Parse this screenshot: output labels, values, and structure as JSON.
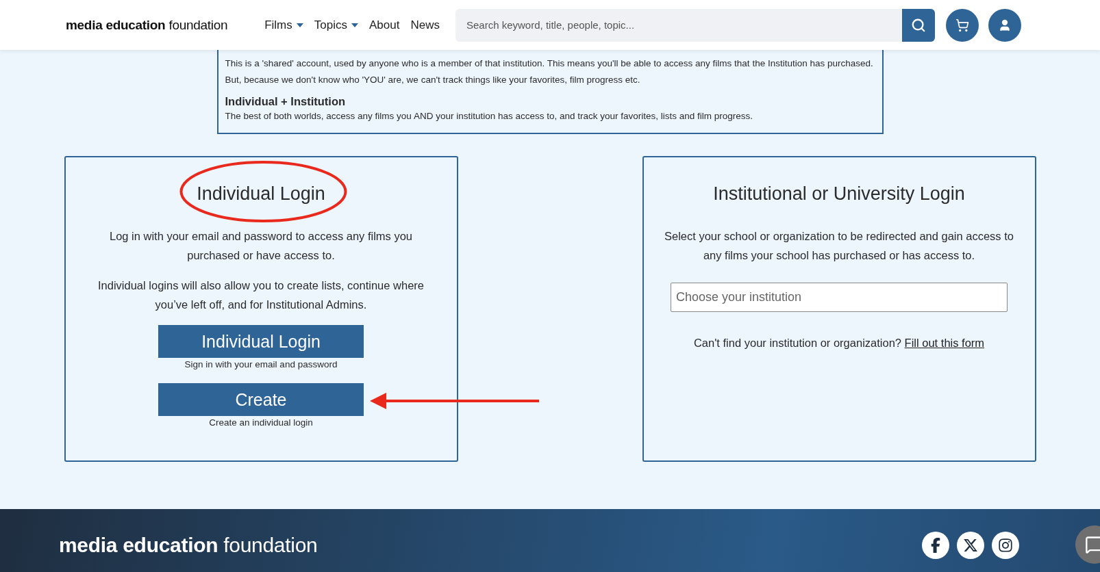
{
  "header": {
    "logo": "**media education** foundation",
    "nav": [
      {
        "label": "Films",
        "dropdown": true
      },
      {
        "label": "Topics",
        "dropdown": true
      },
      {
        "label": "About",
        "dropdown": false
      },
      {
        "label": "News",
        "dropdown": false
      }
    ],
    "search": {
      "placeholder": "Search keyword, title, people, topic..."
    }
  },
  "info_box": {
    "paragraph": "This is a 'shared' account, used by anyone who is a member of that institution. This means you'll be able to access any films that the Institution has purchased. But, because we don't know who 'YOU' are, we can't track things like your favorites, film progress etc.",
    "heading": "Individual + Institution",
    "description": "The best of both worlds, access any films you AND your institution has access to, and track your favorites, lists and film progress."
  },
  "individual_login": {
    "title": "Individual Login",
    "paragraphs": [
      "Log in with your email and password to access any films you purchased or have access to.",
      "Individual logins will also allow you to create lists, continue where you’ve left off, and for Institutional Admins."
    ],
    "buttons": [
      {
        "label": "Individual Login",
        "caption": "Sign in with your email and password"
      },
      {
        "label": "Create",
        "caption": "Create an individual login"
      }
    ]
  },
  "institution_login": {
    "title": "Institutional or University Login",
    "paragraph": "Select your school or organization to be redirected and gain access to any films your school has purchased or has access to.",
    "field": {
      "placeholder": "Choose your institution"
    },
    "help_text": "Can't find your institution or organization?",
    "link": "Fill out this form"
  },
  "footer": {
    "logo": "**media education** foundation"
  }
}
